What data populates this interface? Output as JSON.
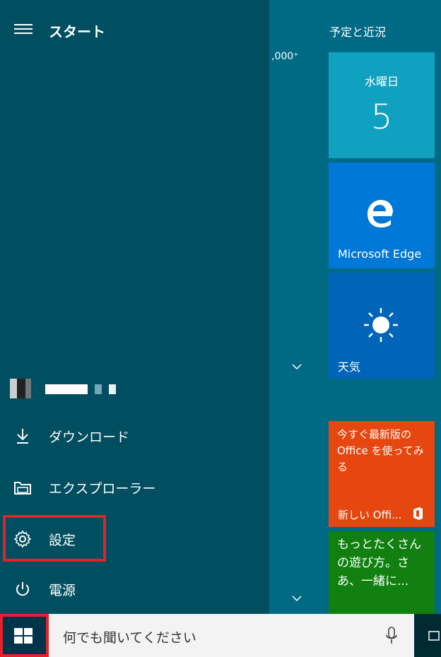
{
  "start": {
    "title": "スタート"
  },
  "middle": {
    "count": ",000⁺"
  },
  "menu": [
    {
      "label": "ダウンロード"
    },
    {
      "label": "エクスプローラー"
    },
    {
      "label": "設定"
    },
    {
      "label": "電源"
    }
  ],
  "tiles": {
    "header": "予定と近況",
    "calendar": {
      "day": "水曜日",
      "date": "5"
    },
    "edge": {
      "label": "Microsoft Edge"
    },
    "weather": {
      "label": "天気"
    },
    "office": {
      "text": "今すぐ最新版の Office を使ってみる",
      "label": "新しい Offi..."
    },
    "xbox": {
      "text": "もっとたくさんの遊び方。さあ、一緒に..."
    }
  },
  "taskbar": {
    "search_text": "何でも聞いてください"
  },
  "colors": {
    "left_bg": "#004e5f",
    "right_bg": "#006a84",
    "calendar_tile": "#10a1c0",
    "edge_tile": "#0078d7",
    "weather_tile": "#0064b8",
    "office_tile": "#e6460f",
    "xbox_tile": "#118011",
    "highlight": "#e8202a"
  }
}
